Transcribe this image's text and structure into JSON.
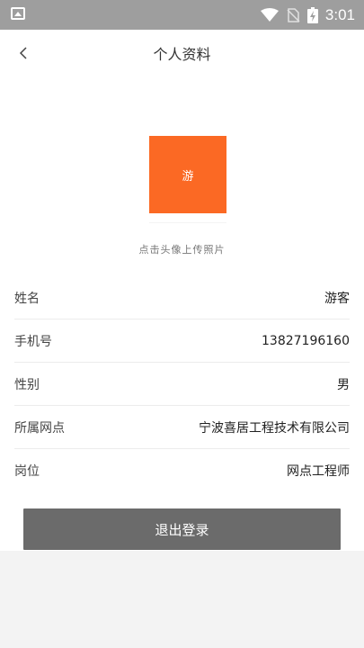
{
  "status_bar": {
    "time": "3:01",
    "icons": [
      "image-icon",
      "wifi-icon",
      "no-sim-icon",
      "battery-charging-icon"
    ]
  },
  "header": {
    "title": "个人资料",
    "back_icon": "chevron-left-icon"
  },
  "avatar": {
    "text": "游",
    "color": "#fb6924"
  },
  "upload_hint": "点击头像上传照片",
  "profile_fields": [
    {
      "label": "姓名",
      "value": "游客"
    },
    {
      "label": "手机号",
      "value": "13827196160"
    },
    {
      "label": "性别",
      "value": "男"
    },
    {
      "label": "所属网点",
      "value": "宁波喜居工程技术有限公司"
    },
    {
      "label": "岗位",
      "value": "网点工程师"
    }
  ],
  "logout_label": "退出登录",
  "colors": {
    "status_bar": "#9e9e9e",
    "avatar_bg": "#fb6924",
    "button_bg": "#6b6b6b",
    "page_bottom": "#f3f3f3"
  }
}
